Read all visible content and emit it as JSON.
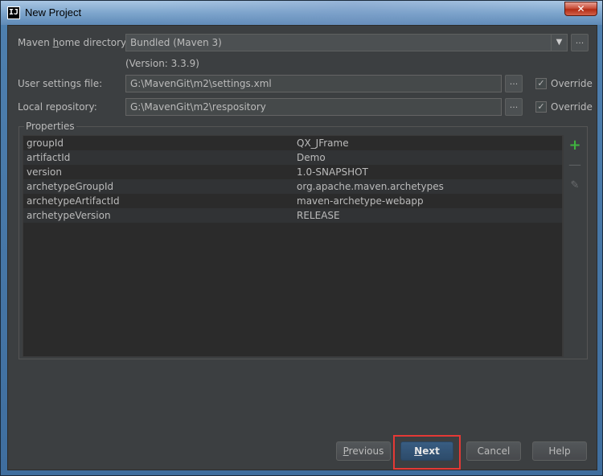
{
  "window": {
    "title": "New Project",
    "app_icon": "IJ",
    "close_glyph": "✕"
  },
  "form": {
    "maven_home": {
      "label_pre": "Maven ",
      "label_mnemonic": "h",
      "label_post": "ome directory:",
      "value": "Bundled (Maven 3)",
      "version": "(Version: 3.3.9)",
      "browse": "..."
    },
    "user_settings": {
      "label": "User settings file:",
      "value": "G:\\MavenGit\\m2\\settings.xml",
      "browse": "...",
      "override_label": "Override",
      "override_checked": true
    },
    "local_repo": {
      "label": "Local repository:",
      "value": "G:\\MavenGit\\m2\\respository",
      "browse": "...",
      "override_label": "Override",
      "override_checked": true
    }
  },
  "properties": {
    "title": "Properties",
    "rows": [
      {
        "key": "groupId",
        "value": "QX_JFrame"
      },
      {
        "key": "artifactId",
        "value": "Demo"
      },
      {
        "key": "version",
        "value": "1.0-SNAPSHOT"
      },
      {
        "key": "archetypeGroupId",
        "value": "org.apache.maven.archetypes"
      },
      {
        "key": "archetypeArtifactId",
        "value": "maven-archetype-webapp"
      },
      {
        "key": "archetypeVersion",
        "value": "RELEASE"
      }
    ],
    "tools": {
      "add": "+",
      "remove": "—",
      "edit": "✎"
    }
  },
  "buttons": {
    "previous": {
      "mnemonic": "P",
      "rest": "revious"
    },
    "next": {
      "mnemonic": "N",
      "rest": "ext"
    },
    "cancel": "Cancel",
    "help": "Help"
  },
  "colors": {
    "dialog_bg": "#3c3f41",
    "table_bg": "#2b2b2b",
    "default_button": "#365880",
    "highlight": "#e53935",
    "add_icon": "#3fb43f"
  }
}
